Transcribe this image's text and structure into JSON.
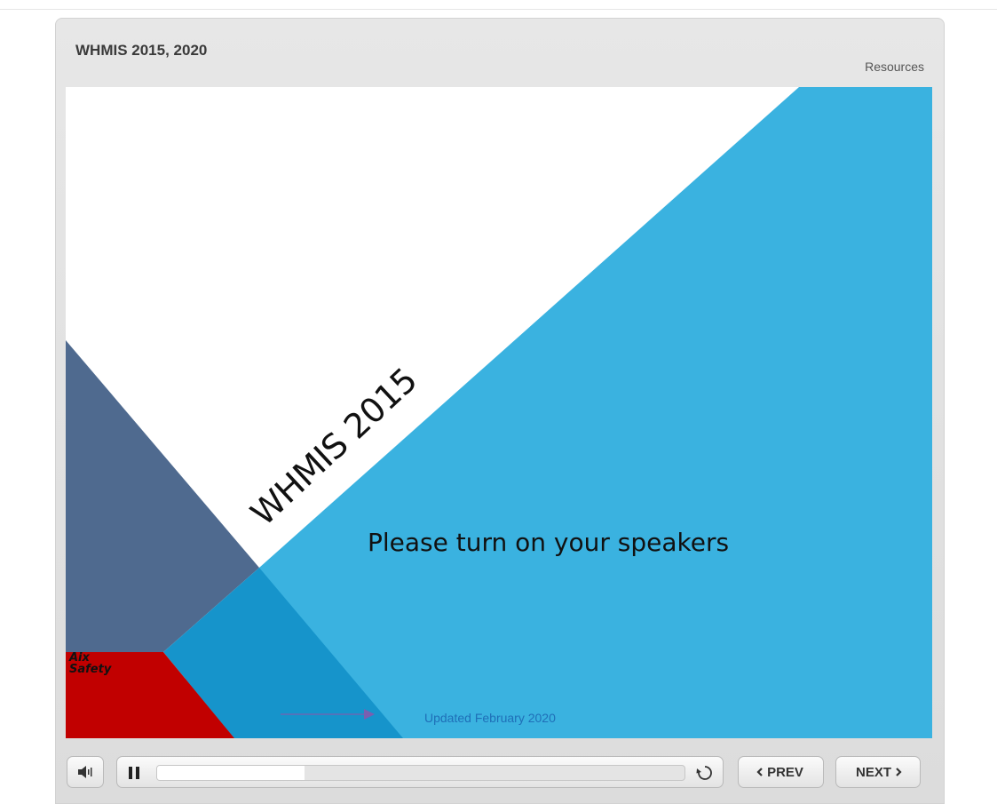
{
  "player": {
    "title": "WHMIS 2015, 2020",
    "resources_label": "Resources"
  },
  "slide": {
    "title": "WHMIS 2015",
    "subtitle": "Please turn on your speakers",
    "brand_line1": "Aix",
    "brand_line2": "Safety",
    "updated": "Updated February 2020",
    "colors": {
      "light_blue": "#3ab2e0",
      "mid_blue": "#1694cb",
      "slate": "#4f6a8f",
      "red": "#c10000",
      "arrow": "#7a5fb0"
    }
  },
  "controls": {
    "audio_icon": "speaker-icon",
    "playpause_icon": "pause-icon",
    "replay_icon": "replay-icon",
    "progress": 0.28,
    "prev_label": "PREV",
    "next_label": "NEXT",
    "prev_icon": "chevron-left-icon",
    "next_icon": "chevron-right-icon"
  }
}
